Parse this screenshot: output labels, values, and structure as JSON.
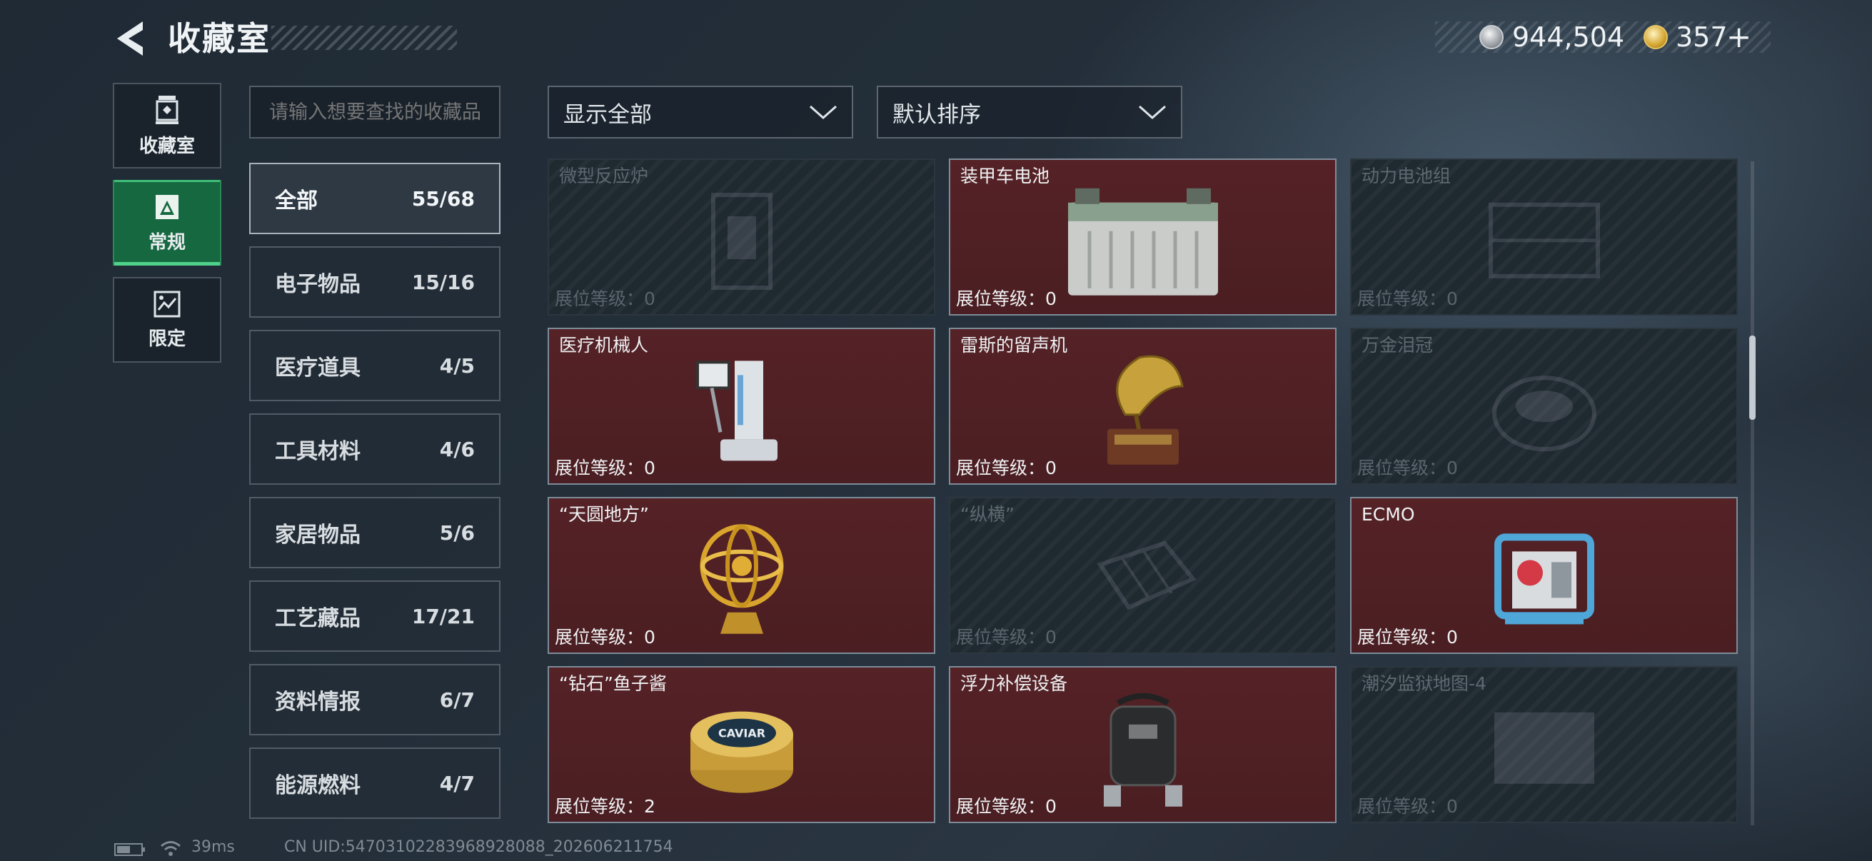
{
  "header": {
    "title": "收藏室"
  },
  "currency": {
    "silver": "944,504",
    "gold": "357",
    "gold_plus": "+"
  },
  "nav_tabs": [
    {
      "label": "收藏室",
      "icon": "collection-room-icon",
      "active": false
    },
    {
      "label": "常规",
      "icon": "regular-icon",
      "active": true
    },
    {
      "label": "限定",
      "icon": "limited-icon",
      "active": false
    }
  ],
  "search": {
    "placeholder": "请输入想要查找的收藏品"
  },
  "filters": {
    "show": "显示全部",
    "sort": "默认排序"
  },
  "categories": [
    {
      "label": "全部",
      "count": "55/68",
      "active": true
    },
    {
      "label": "电子物品",
      "count": "15/16"
    },
    {
      "label": "医疗道具",
      "count": "4/5"
    },
    {
      "label": "工具材料",
      "count": "4/6"
    },
    {
      "label": "家居物品",
      "count": "5/6"
    },
    {
      "label": "工艺藏品",
      "count": "17/21"
    },
    {
      "label": "资料情报",
      "count": "6/7"
    },
    {
      "label": "能源燃料",
      "count": "4/7"
    }
  ],
  "level_label": "展位等级：",
  "items": [
    {
      "name": "微型反应炉",
      "level": "0",
      "filled": false,
      "icon": "reactor-icon"
    },
    {
      "name": "装甲车电池",
      "level": "0",
      "filled": true,
      "icon": "battery-icon"
    },
    {
      "name": "动力电池组",
      "level": "0",
      "filled": false,
      "icon": "battery-pack-icon"
    },
    {
      "name": "医疗机械人",
      "level": "0",
      "filled": true,
      "icon": "medical-robot-icon"
    },
    {
      "name": "雷斯的留声机",
      "level": "0",
      "filled": true,
      "icon": "gramophone-icon"
    },
    {
      "name": "万金泪冠",
      "level": "0",
      "filled": false,
      "icon": "crown-icon"
    },
    {
      "name": "“天圆地方”",
      "level": "0",
      "filled": true,
      "icon": "armillary-sphere-icon"
    },
    {
      "name": "“纵横”",
      "level": "0",
      "filled": false,
      "icon": "chessboard-icon"
    },
    {
      "name": "ECMO",
      "level": "0",
      "filled": true,
      "icon": "ecmo-machine-icon"
    },
    {
      "name": "“钻石”鱼子酱",
      "level": "2",
      "filled": true,
      "icon": "caviar-tin-icon",
      "tin_text": "CAVIAR"
    },
    {
      "name": "浮力补偿设备",
      "level": "0",
      "filled": true,
      "icon": "buoyancy-device-icon"
    },
    {
      "name": "潮汐监狱地图-4",
      "level": "0",
      "filled": false,
      "icon": "map-icon"
    }
  ],
  "status": {
    "ping": "39ms",
    "uid": "CN UID:5470310228396892808​8_202606211754"
  }
}
